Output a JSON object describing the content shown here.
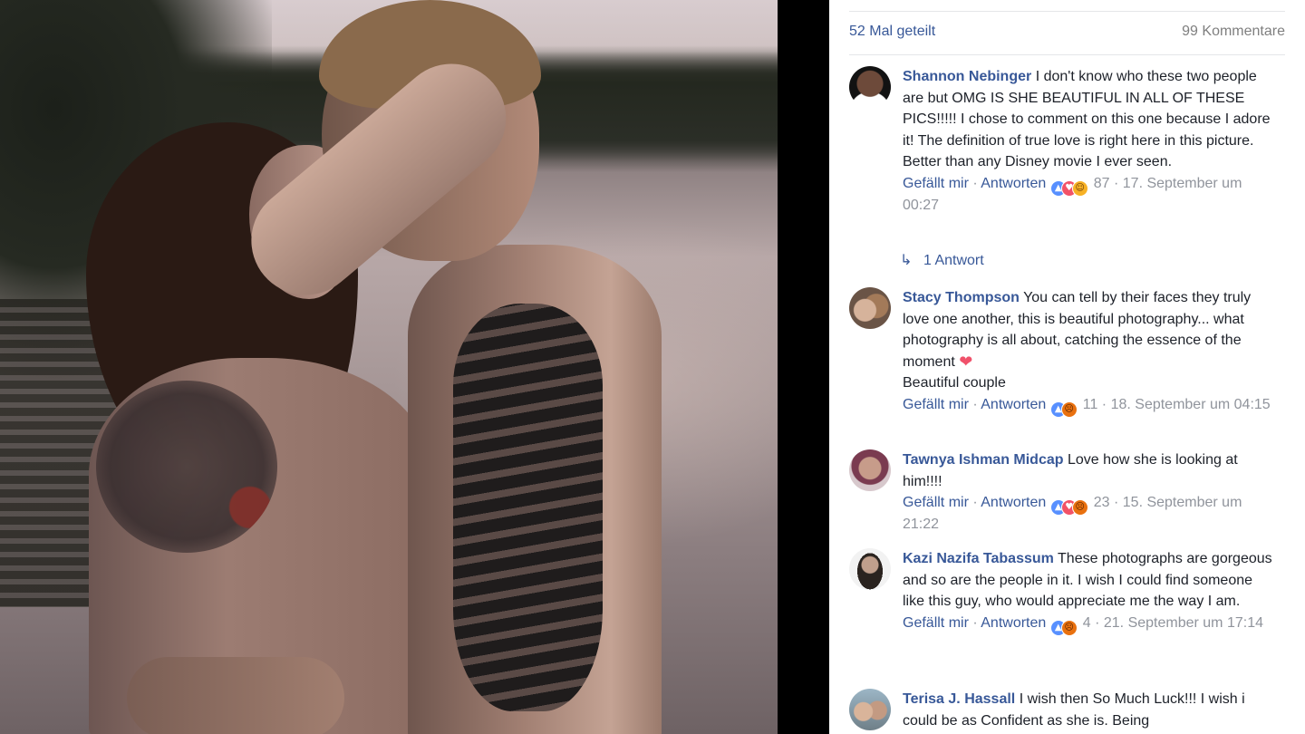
{
  "stats": {
    "shares": "52 Mal geteilt",
    "comments": "99 Kommentare"
  },
  "actions": {
    "like": "Gefällt mir",
    "reply": "Antworten",
    "sep": " · "
  },
  "comments": [
    {
      "name": "Shannon Nebinger",
      "text": "I don't know who these two people are but OMG IS SHE BEAUTIFUL IN ALL OF THESE PICS!!!!! I chose to comment on this one because I adore it! The definition of true love is right here in this picture. Better than any Disney movie I ever seen.",
      "reactions": [
        "like",
        "love",
        "haha"
      ],
      "count": "87",
      "date": "17. September um 00:27",
      "replies": "1 Antwort"
    },
    {
      "name": "Stacy Thompson",
      "text": "You can tell by their faces they truly love one another, this is beautiful photography... what photography is all about, catching the essence of the moment",
      "text2": "Beautiful couple",
      "reactions": [
        "like",
        "angry"
      ],
      "count": "11",
      "date": "18. September um 04:15"
    },
    {
      "name": "Tawnya Ishman Midcap",
      "text": "Love how she is looking at him!!!!",
      "reactions": [
        "like",
        "love",
        "angry"
      ],
      "count": "23",
      "date": "15. September um 21:22"
    },
    {
      "name": "Kazi Nazifa Tabassum",
      "text": "These photographs are gorgeous and so are the people in it. I wish I could find someone like this guy, who would appreciate me the way I am.",
      "reactions": [
        "like",
        "angry"
      ],
      "count": "4",
      "date": "21. September um 17:14"
    },
    {
      "name": "Terisa J. Hassall",
      "text": "I wish then So Much Luck!!! I wish i could be as Confident as she is. Being"
    }
  ],
  "icons": {
    "reply_arrow": "↳",
    "heart": "❤",
    "like": "👍",
    "love": "♥",
    "haha": "☺",
    "angry": "☹"
  },
  "colors": {
    "link": "#385898",
    "meta": "#90949c",
    "text": "#1d2129"
  }
}
